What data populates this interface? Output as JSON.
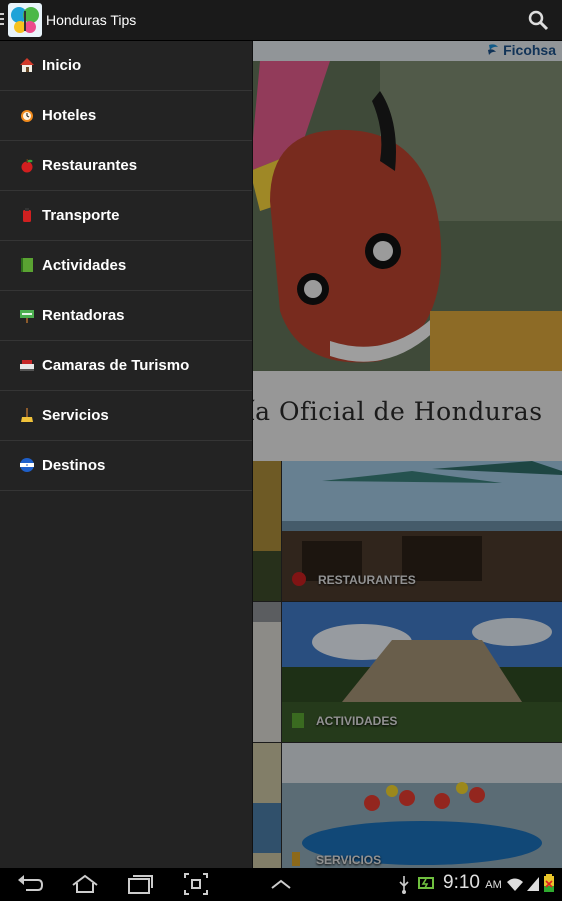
{
  "app": {
    "title": "Honduras Tips"
  },
  "header": {
    "sponsor": "Ficohsa"
  },
  "banner": {
    "title": "uía Oficial de Honduras"
  },
  "drawer": {
    "items": [
      {
        "label": "Inicio",
        "icon": "home-icon"
      },
      {
        "label": "Hoteles",
        "icon": "alarm-clock-icon"
      },
      {
        "label": "Restaurantes",
        "icon": "apple-icon"
      },
      {
        "label": "Transporte",
        "icon": "fuel-can-icon"
      },
      {
        "label": "Actividades",
        "icon": "notebook-icon"
      },
      {
        "label": "Rentadoras",
        "icon": "sign-icon"
      },
      {
        "label": "Camaras de Turismo",
        "icon": "cash-register-icon"
      },
      {
        "label": "Servicios",
        "icon": "broom-icon"
      },
      {
        "label": "Destinos",
        "icon": "flag-icon"
      }
    ]
  },
  "tiles": {
    "restaurantes": "RESTAURANTES",
    "actividades": "ACTIVIDADES",
    "servicios": "SERVICIOS"
  },
  "status": {
    "time": "9:10",
    "ampm": "AM"
  }
}
